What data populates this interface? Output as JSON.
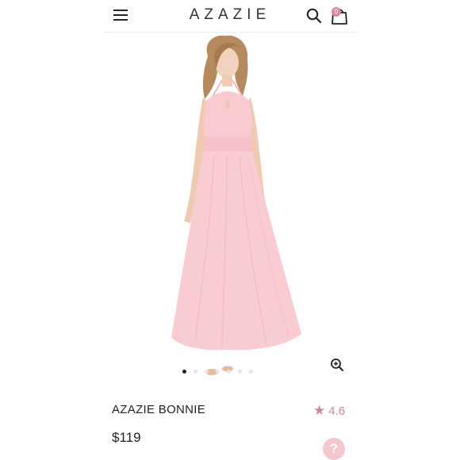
{
  "header": {
    "brand": "AZAZIE",
    "cart_count": "0",
    "menu_icon": "hamburger-menu-icon",
    "search_icon": "search-icon",
    "cart_icon": "shopping-bag-icon"
  },
  "product": {
    "name": "AZAZIE BONNIE",
    "price": "$119",
    "rating": "4.6",
    "rating_icon": "star-icon",
    "image": "pink halter chiffon bridesmaid dress worn by model",
    "gallery_total_dots": 7,
    "gallery_active_index": 0,
    "zoom_icon": "zoom-in-icon"
  },
  "help": {
    "label": "?"
  },
  "colors": {
    "accent": "#c98896",
    "dress": "#f9c9cf",
    "help_button": "#f4c6cd",
    "text": "#222222"
  }
}
